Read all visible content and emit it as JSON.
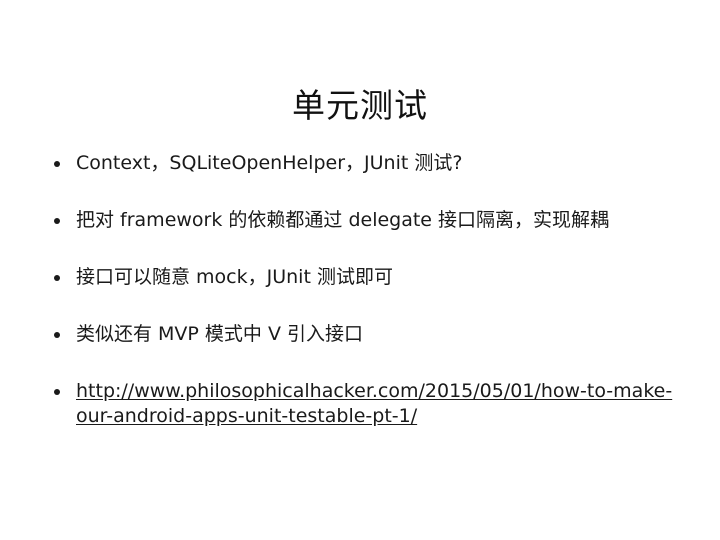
{
  "slide": {
    "title": "单元测试",
    "bullets": [
      {
        "text": "Context，SQLiteOpenHelper，JUnit 测试?"
      },
      {
        "text": "把对 framework 的依赖都通过 delegate 接口隔离，实现解耦"
      },
      {
        "text": "接口可以随意 mock，JUnit 测试即可"
      },
      {
        "text": "类似还有 MVP 模式中 V 引入接口"
      },
      {
        "link": "http://www.philosophicalhacker.com/2015/05/01/how-to-make-our-android-apps-unit-testable-pt-1/"
      }
    ]
  }
}
